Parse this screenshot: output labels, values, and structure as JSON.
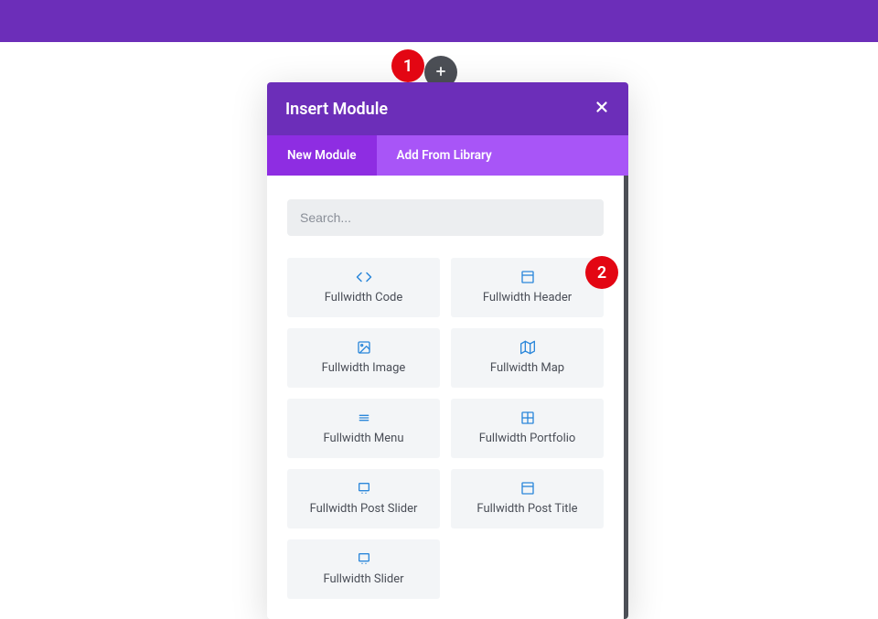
{
  "header": {
    "title": "Insert Module"
  },
  "tabs": {
    "new": "New Module",
    "library": "Add From Library"
  },
  "search": {
    "placeholder": "Search..."
  },
  "modules": {
    "code": "Fullwidth Code",
    "headerm": "Fullwidth Header",
    "image": "Fullwidth Image",
    "map": "Fullwidth Map",
    "menu": "Fullwidth Menu",
    "portfolio": "Fullwidth Portfolio",
    "postslider": "Fullwidth Post Slider",
    "posttitle": "Fullwidth Post Title",
    "slider": "Fullwidth Slider"
  },
  "badges": {
    "one": "1",
    "two": "2"
  }
}
